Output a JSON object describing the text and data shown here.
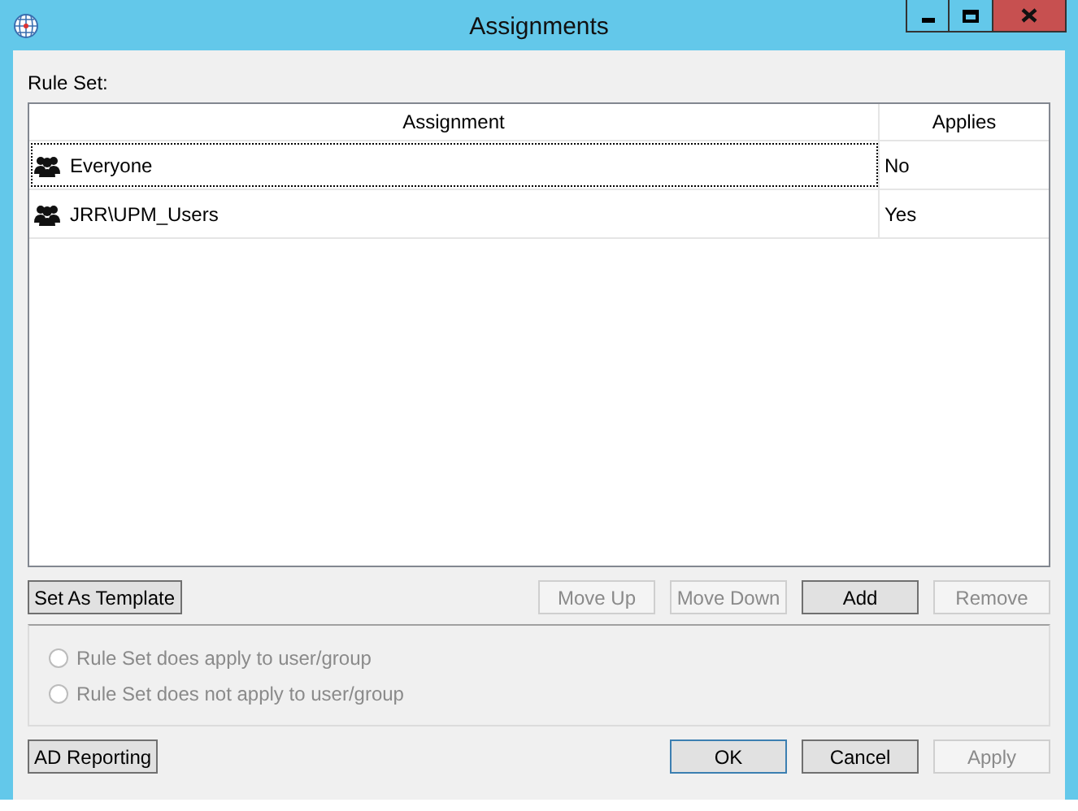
{
  "window": {
    "title": "Assignments"
  },
  "rule_set_label": "Rule Set:",
  "table": {
    "columns": [
      "Assignment",
      "Applies"
    ],
    "rows": [
      {
        "assignment": "Everyone",
        "applies": "No",
        "focused": true
      },
      {
        "assignment": "JRR\\UPM_Users",
        "applies": "Yes",
        "focused": false
      }
    ]
  },
  "left_button": {
    "label": "Set As Template",
    "disabled": false
  },
  "list_buttons": [
    {
      "label": "Move Up",
      "disabled": true
    },
    {
      "label": "Move Down",
      "disabled": true
    },
    {
      "label": "Add",
      "disabled": false
    },
    {
      "label": "Remove",
      "disabled": true
    }
  ],
  "options": [
    {
      "label": "Rule Set does apply to user/group",
      "selected": false,
      "disabled": true
    },
    {
      "label": "Rule Set does not apply to user/group",
      "selected": false,
      "disabled": true
    }
  ],
  "report_button": {
    "label": "AD Reporting",
    "disabled": false
  },
  "dialog_buttons": [
    {
      "label": "OK",
      "disabled": false,
      "default": true
    },
    {
      "label": "Cancel",
      "disabled": false,
      "default": false
    },
    {
      "label": "Apply",
      "disabled": true,
      "default": false
    }
  ]
}
